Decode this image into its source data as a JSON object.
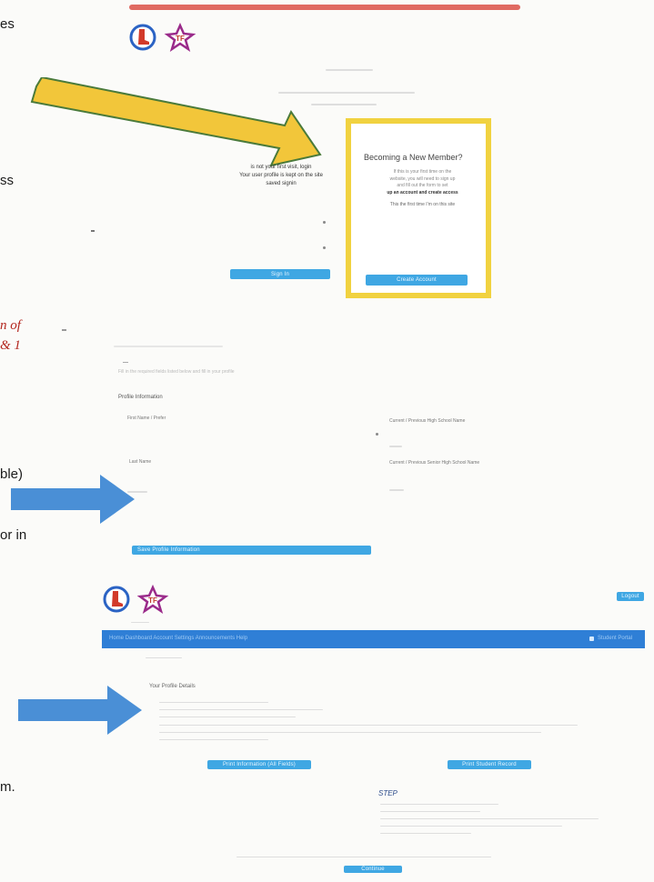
{
  "side_text": {
    "es": "es",
    "ss": "ss",
    "red_line1": "n of",
    "red_line2": "& 1",
    "ble": "ble)",
    "or_in": "or in",
    "m": "m."
  },
  "login_panel": {
    "text_lines": [
      "is not your first visit, login",
      "Your user profile is kept on the site",
      "saved signin"
    ],
    "sign_in_label": "Sign In"
  },
  "new_member_box": {
    "title": "Becoming a New Member?",
    "text_lines": [
      "If this is your first time on the",
      "website, you will need to sign up",
      "and fill out the form to set",
      "up an account and create access"
    ],
    "note": "This the first time I’m on this site",
    "button_label": "Create Account"
  },
  "form_section": {
    "heading_line": "Fill in the required fields listed below and fill in your profile",
    "section_label": "Profile Information",
    "field_1": "First Name / Prefer",
    "field_2": "Current / Previous High School Name",
    "field_3": "Last Name",
    "field_4": "Current / Previous Senior High School Name",
    "submit_label": "Save Profile Information"
  },
  "portal": {
    "top_button_label": "Logout",
    "nav_text": "Home   Dashboard   Account Settings   Announcements   Help",
    "nav_right_text": "Student Portal",
    "welcome_label": "Your Profile Details",
    "button_left_label": "Print Information (All Fields)",
    "button_right_label": "Print Student Record",
    "step_label": "STEP",
    "bottom_button_label": "Continue"
  },
  "colors": {
    "red_bar": "#e06a62",
    "yellow_arrow": "#f2c63a",
    "yellow_box": "#f1d240",
    "blue_arrow": "#4a8fd6",
    "nav_blue": "#2f7fd6",
    "button_blue": "#3fa7e3"
  },
  "icons": {
    "logo_primary": "boot-badge-icon",
    "logo_secondary": "star-badge-icon"
  }
}
